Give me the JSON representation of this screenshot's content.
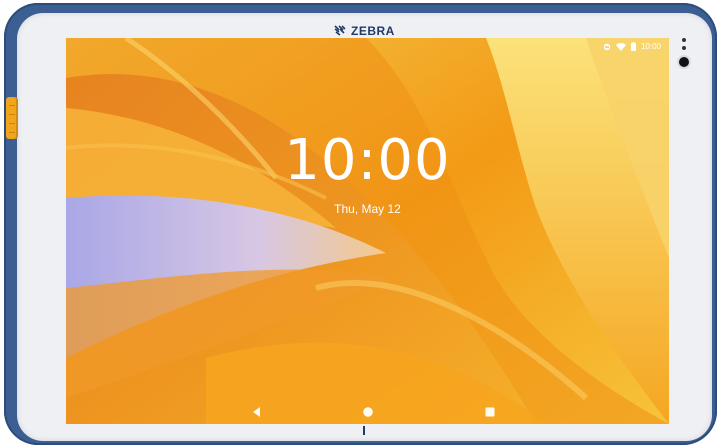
{
  "device": {
    "brand": "ZEBRA"
  },
  "status_bar": {
    "time": "10:00",
    "icons": [
      "do-not-disturb-icon",
      "wifi-icon",
      "battery-icon"
    ]
  },
  "lock_screen": {
    "clock": "10:00",
    "date": "Thu, May 12"
  },
  "nav_bar": {
    "buttons": [
      "back-icon",
      "home-icon",
      "recents-icon"
    ]
  },
  "colors": {
    "bumper": "#3b5e93",
    "bezel": "#eef0f4",
    "accent_key": "#f0a51a",
    "wallpaper_primary": "#f4a21a",
    "wallpaper_light": "#f7d36a",
    "wallpaper_violet": "#b9b3e8"
  }
}
